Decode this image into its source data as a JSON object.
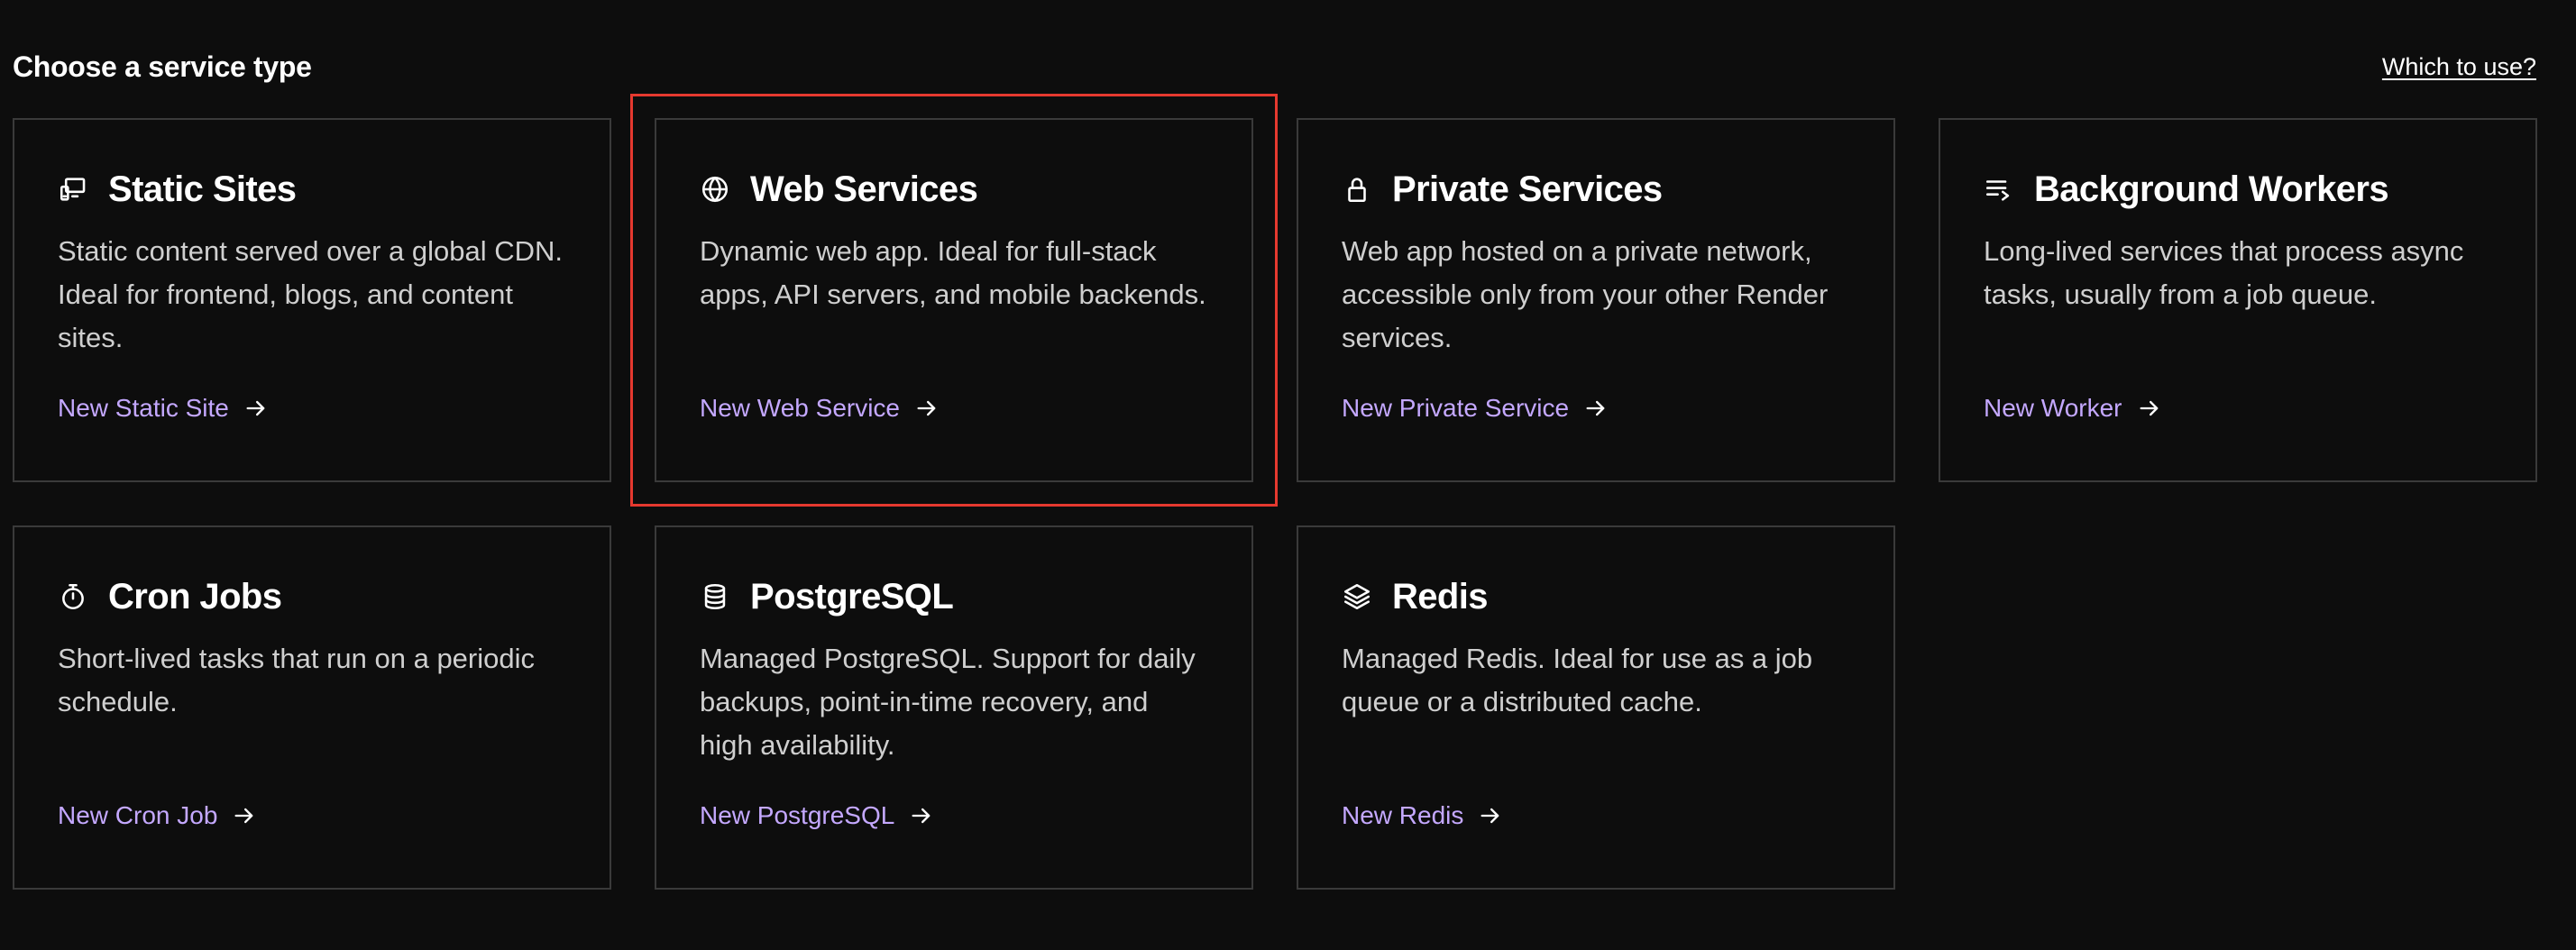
{
  "header": {
    "title": "Choose a service type",
    "help_link": "Which to use?"
  },
  "highlight_color": "#e5392f",
  "link_color": "#c4a8ff",
  "cards": [
    {
      "icon": "static-site-icon",
      "title": "Static Sites",
      "description": "Static content served over a global CDN. Ideal for frontend, blogs, and content sites.",
      "link": "New Static Site",
      "highlighted": false
    },
    {
      "icon": "globe-icon",
      "title": "Web Services",
      "description": "Dynamic web app. Ideal for full-stack apps, API servers, and mobile backends.",
      "link": "New Web Service",
      "highlighted": true
    },
    {
      "icon": "lock-icon",
      "title": "Private Services",
      "description": "Web app hosted on a private network, accessible only from your other Render services.",
      "link": "New Private Service",
      "highlighted": false
    },
    {
      "icon": "queue-icon",
      "title": "Background Workers",
      "description": "Long-lived services that process async tasks, usually from a job queue.",
      "link": "New Worker",
      "highlighted": false
    },
    {
      "icon": "stopwatch-icon",
      "title": "Cron Jobs",
      "description": "Short-lived tasks that run on a periodic schedule.",
      "link": "New Cron Job",
      "highlighted": false
    },
    {
      "icon": "database-icon",
      "title": "PostgreSQL",
      "description": "Managed PostgreSQL. Support for daily backups, point-in-time recovery, and high availability.",
      "link": "New PostgreSQL",
      "highlighted": false
    },
    {
      "icon": "layers-icon",
      "title": "Redis",
      "description": "Managed Redis. Ideal for use as a job queue or a distributed cache.",
      "link": "New Redis",
      "highlighted": false
    }
  ]
}
